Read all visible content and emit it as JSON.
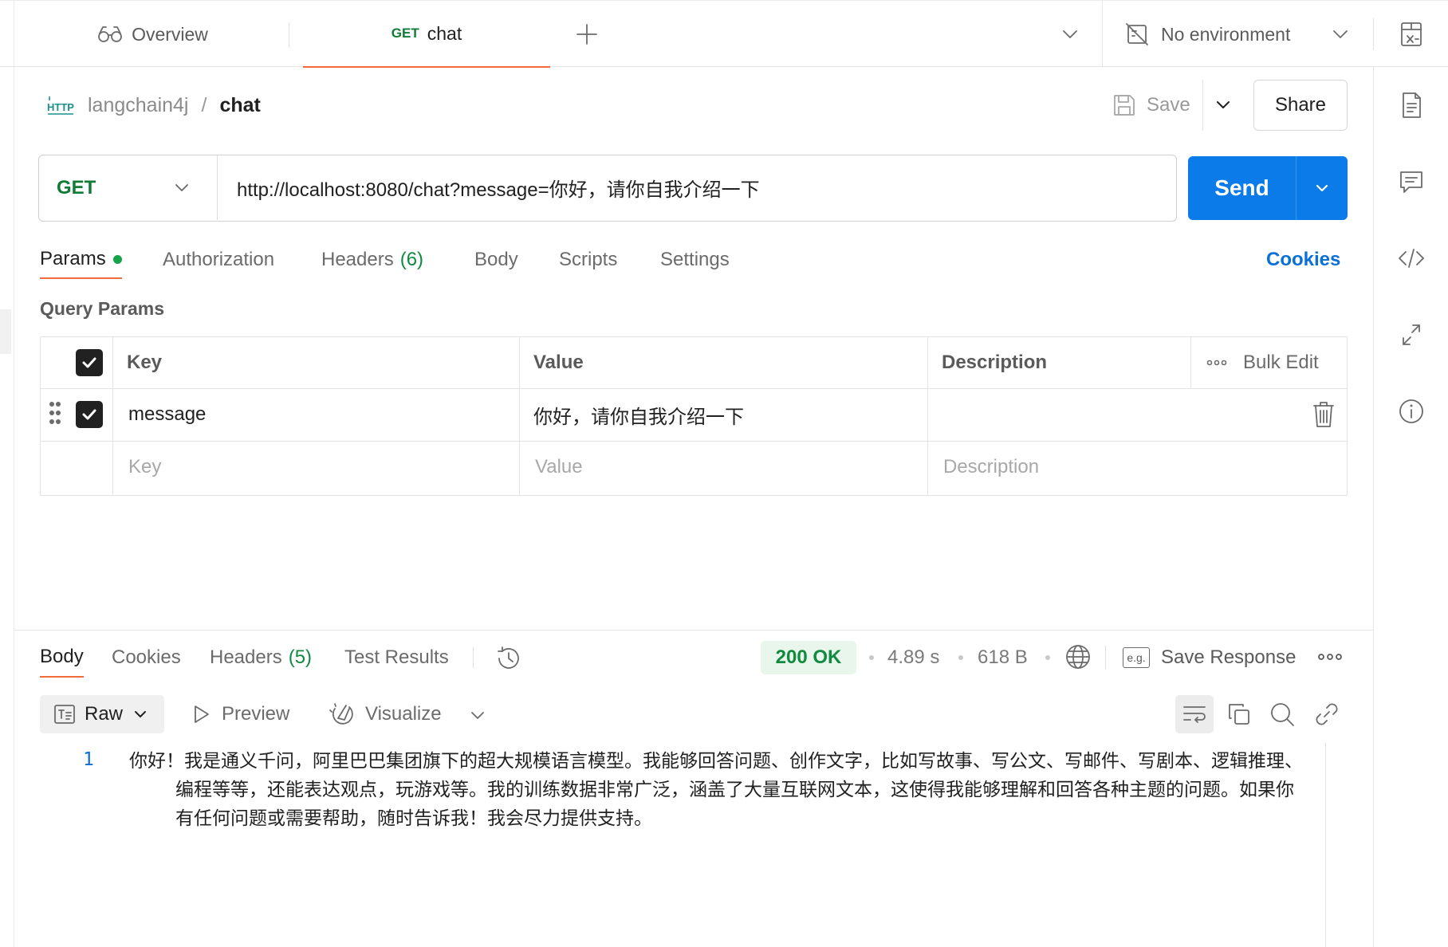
{
  "tabs": {
    "overview_label": "Overview",
    "chat_method": "GET",
    "chat_label": "chat"
  },
  "environment": {
    "label": "No environment"
  },
  "breadcrumb": {
    "collection": "langchain4j",
    "separator": "/",
    "request": "chat",
    "icon_text": "HTTP"
  },
  "toolbar": {
    "save_label": "Save",
    "share_label": "Share"
  },
  "request": {
    "method": "GET",
    "url": "http://localhost:8080/chat?message=你好，请你自我介绍一下",
    "send_label": "Send"
  },
  "request_tabs": {
    "params": "Params",
    "authorization": "Authorization",
    "headers": "Headers",
    "headers_count": "(6)",
    "body": "Body",
    "scripts": "Scripts",
    "settings": "Settings",
    "cookies": "Cookies"
  },
  "query_params": {
    "label": "Query Params",
    "headers": {
      "key": "Key",
      "value": "Value",
      "description": "Description",
      "bulk_edit": "Bulk Edit"
    },
    "rows": [
      {
        "key": "message",
        "value": "你好，请你自我介绍一下",
        "description": ""
      }
    ],
    "placeholders": {
      "key": "Key",
      "value": "Value",
      "description": "Description"
    }
  },
  "response_tabs": {
    "body": "Body",
    "cookies": "Cookies",
    "headers": "Headers",
    "headers_count": "(5)",
    "test_results": "Test Results"
  },
  "response_meta": {
    "status": "200 OK",
    "time": "4.89 s",
    "size": "618 B",
    "save_response": "Save Response",
    "eg_badge": "e.g."
  },
  "response_format": {
    "raw": "Raw",
    "preview": "Preview",
    "visualize": "Visualize"
  },
  "response_body": {
    "line_number": "1",
    "text": "你好！我是通义千问，阿里巴巴集团旗下的超大规模语言模型。我能够回答问题、创作文字，比如写故事、写公文、写邮件、写剧本、逻辑推理、编程等等，还能表达观点，玩游戏等。我的训练数据非常广泛，涵盖了大量互联网文本，这使得我能够理解和回答各种主题的问题。如果你有任何问题或需要帮助，随时告诉我！我会尽力提供支持。"
  },
  "colors": {
    "accent_orange": "#f26b3a",
    "send_blue": "#0a7be8",
    "method_green": "#0f7b37",
    "status_green": "#0f8a3f"
  }
}
